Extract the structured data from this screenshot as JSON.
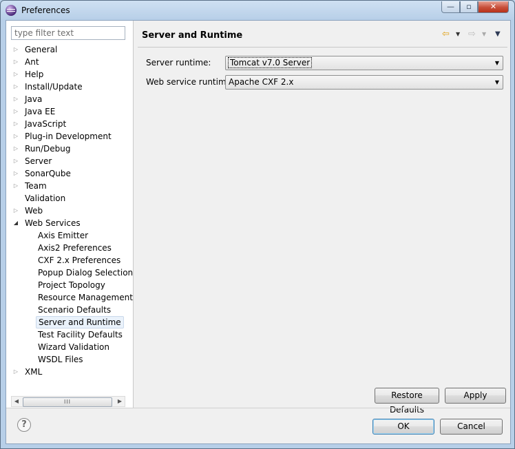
{
  "window": {
    "title": "Preferences",
    "minimize_glyph": "—",
    "maximize_glyph": "▫",
    "close_glyph": "✕"
  },
  "filter": {
    "placeholder": "type filter text"
  },
  "tree": {
    "collapsed_glyph": "▷",
    "expanded_glyph": "◢",
    "items": [
      {
        "label": "General",
        "expandable": true
      },
      {
        "label": "Ant",
        "expandable": true
      },
      {
        "label": "Help",
        "expandable": true
      },
      {
        "label": "Install/Update",
        "expandable": true
      },
      {
        "label": "Java",
        "expandable": true
      },
      {
        "label": "Java EE",
        "expandable": true
      },
      {
        "label": "JavaScript",
        "expandable": true
      },
      {
        "label": "Plug-in Development",
        "expandable": true
      },
      {
        "label": "Run/Debug",
        "expandable": true
      },
      {
        "label": "Server",
        "expandable": true
      },
      {
        "label": "SonarQube",
        "expandable": true
      },
      {
        "label": "Team",
        "expandable": true
      },
      {
        "label": "Validation",
        "expandable": false
      },
      {
        "label": "Web",
        "expandable": true
      },
      {
        "label": "Web Services",
        "expandable": true,
        "expanded": true
      },
      {
        "label": "Axis Emitter",
        "child": true
      },
      {
        "label": "Axis2 Preferences",
        "child": true
      },
      {
        "label": "CXF 2.x Preferences",
        "child": true
      },
      {
        "label": "Popup Dialog Selection",
        "child": true
      },
      {
        "label": "Project Topology",
        "child": true
      },
      {
        "label": "Resource Management",
        "child": true
      },
      {
        "label": "Scenario Defaults",
        "child": true
      },
      {
        "label": "Server and Runtime",
        "child": true,
        "selected": true
      },
      {
        "label": "Test Facility Defaults",
        "child": true
      },
      {
        "label": "Wizard Validation",
        "child": true
      },
      {
        "label": "WSDL Files",
        "child": true
      },
      {
        "label": "XML",
        "expandable": true
      }
    ]
  },
  "scrollbar": {
    "left_arrow": "◀",
    "right_arrow": "▶",
    "grip": "III"
  },
  "page": {
    "title": "Server and Runtime",
    "nav": {
      "back_icon": "⇦",
      "forward_icon": "⇨",
      "menu_glyph": "▼"
    },
    "fields": [
      {
        "label": "Server runtime:",
        "value": "Tomcat v7.0 Server",
        "focused": true
      },
      {
        "label": "Web service runtime:",
        "value": "Apache CXF 2.x",
        "focused": false
      }
    ],
    "combo_arrow": "▼",
    "restore_defaults": "Restore Defaults",
    "apply": "Apply"
  },
  "footer": {
    "help_glyph": "?",
    "ok": "OK",
    "cancel": "Cancel"
  }
}
